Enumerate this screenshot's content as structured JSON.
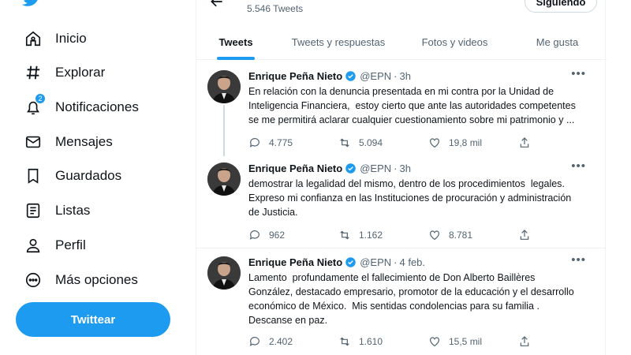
{
  "sidebar": {
    "items": [
      {
        "label": "Inicio",
        "icon": "home-icon"
      },
      {
        "label": "Explorar",
        "icon": "hashtag-icon"
      },
      {
        "label": "Notificaciones",
        "icon": "bell-icon",
        "badge": "2"
      },
      {
        "label": "Mensajes",
        "icon": "envelope-icon"
      },
      {
        "label": "Guardados",
        "icon": "bookmark-icon"
      },
      {
        "label": "Listas",
        "icon": "list-icon"
      },
      {
        "label": "Perfil",
        "icon": "person-icon"
      },
      {
        "label": "Más opciones",
        "icon": "more-circle-icon"
      }
    ],
    "tweet_button": "Twittear"
  },
  "profile_header": {
    "tweet_count": "5.546 Tweets",
    "follow_button": "Siguiendo"
  },
  "tabs": [
    {
      "label": "Tweets",
      "active": true
    },
    {
      "label": "Tweets y respuestas",
      "active": false
    },
    {
      "label": "Fotos y videos",
      "active": false
    },
    {
      "label": "Me gusta",
      "active": false
    }
  ],
  "tweets": [
    {
      "name": "Enrique Peña Nieto",
      "handle": "@EPN",
      "time": "3h",
      "text": "En relación con la denuncia presentada en mi contra por la Unidad de\nInteligencia Financiera,  estoy cierto que ante las autoridades competentes\nse me permitirá aclarar cualquier cuestionamiento sobre mi patrimonio y ...",
      "replies": "4.775",
      "retweets": "5.094",
      "likes": "19,8 mil"
    },
    {
      "name": "Enrique Peña Nieto",
      "handle": "@EPN",
      "time": "3h",
      "text": "demostrar la legalidad del mismo, dentro de los procedimientos  legales.\nExpreso mi confianza en las Instituciones de procuración y administración\nde Justicia.",
      "replies": "962",
      "retweets": "1.162",
      "likes": "8.781"
    },
    {
      "name": "Enrique Peña Nieto",
      "handle": "@EPN",
      "time": "4 feb.",
      "text": "Lamento  profundamente el fallecimiento de Don Alberto Baillères\nGonzález, destacado empresario, promotor de la educación y el desarrollo\neconómico de México.  Mis sentidas condolencias para su familia .\nDescanse en paz.",
      "replies": "2.402",
      "retweets": "1.610",
      "likes": "15,5 mil"
    }
  ],
  "colors": {
    "accent": "#1d9bf0",
    "secondary_text": "#536471"
  }
}
